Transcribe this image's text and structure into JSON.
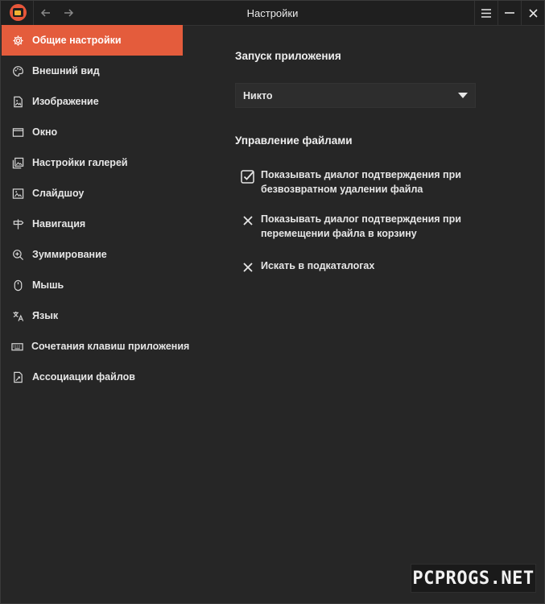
{
  "window": {
    "title": "Настройки"
  },
  "sidebar": {
    "items": [
      {
        "label": "Общие настройки",
        "icon": "gear-icon",
        "active": true
      },
      {
        "label": "Внешний вид",
        "icon": "palette-icon"
      },
      {
        "label": "Изображение",
        "icon": "image-file-icon"
      },
      {
        "label": "Окно",
        "icon": "window-icon"
      },
      {
        "label": "Настройки галерей",
        "icon": "gallery-icon"
      },
      {
        "label": "Слайдшоу",
        "icon": "slideshow-icon"
      },
      {
        "label": "Навигация",
        "icon": "signpost-icon"
      },
      {
        "label": "Зуммирование",
        "icon": "zoom-icon"
      },
      {
        "label": "Мышь",
        "icon": "mouse-icon"
      },
      {
        "label": "Язык",
        "icon": "translate-icon"
      },
      {
        "label": "Сочетания клавиш приложения",
        "icon": "keyboard-icon"
      },
      {
        "label": "Ассоциации файлов",
        "icon": "file-association-icon"
      }
    ]
  },
  "main": {
    "startup": {
      "title": "Запуск приложения",
      "select_value": "Никто"
    },
    "files": {
      "title": "Управление файлами",
      "options": [
        {
          "line1": "Показывать диалог подтверждения при",
          "line2": "безвозвратном удалении файла",
          "checked": true
        },
        {
          "line1": "Показывать диалог подтверждения при",
          "line2": "перемещении файла в корзину",
          "checked": false
        },
        {
          "line1": "Искать в подкаталогах",
          "line2": "",
          "checked": false
        }
      ]
    }
  },
  "watermark": {
    "text": "PCPROGS.NET"
  },
  "colors": {
    "accent": "#e45c3c",
    "background": "#262626",
    "titlebar": "#1f1f1f"
  }
}
